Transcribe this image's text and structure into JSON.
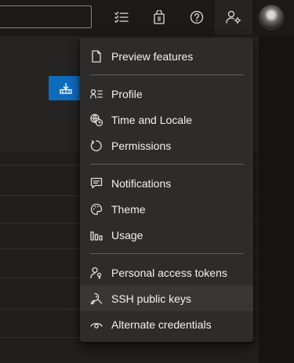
{
  "menu": {
    "sections": [
      [
        {
          "label": "Preview features",
          "icon": "document-icon"
        }
      ],
      [
        {
          "label": "Profile",
          "icon": "profile-card-icon"
        },
        {
          "label": "Time and Locale",
          "icon": "globe-clock-icon"
        },
        {
          "label": "Permissions",
          "icon": "refresh-circle-icon"
        }
      ],
      [
        {
          "label": "Notifications",
          "icon": "chat-bubble-icon"
        },
        {
          "label": "Theme",
          "icon": "palette-icon"
        },
        {
          "label": "Usage",
          "icon": "bar-chart-icon"
        }
      ],
      [
        {
          "label": "Personal access tokens",
          "icon": "person-key-icon"
        },
        {
          "label": "SSH public keys",
          "icon": "key-icon"
        },
        {
          "label": "Alternate credentials",
          "icon": "eye-icon"
        }
      ]
    ],
    "hovered_item": "SSH public keys"
  },
  "topbar": {
    "icons": [
      "checklist-icon",
      "shopping-bag-icon",
      "help-icon",
      "user-settings-icon"
    ]
  },
  "colors": {
    "accent": "#0f6cbd",
    "menu_background": "#2d2c2b",
    "page_background": "#1b1a19"
  }
}
